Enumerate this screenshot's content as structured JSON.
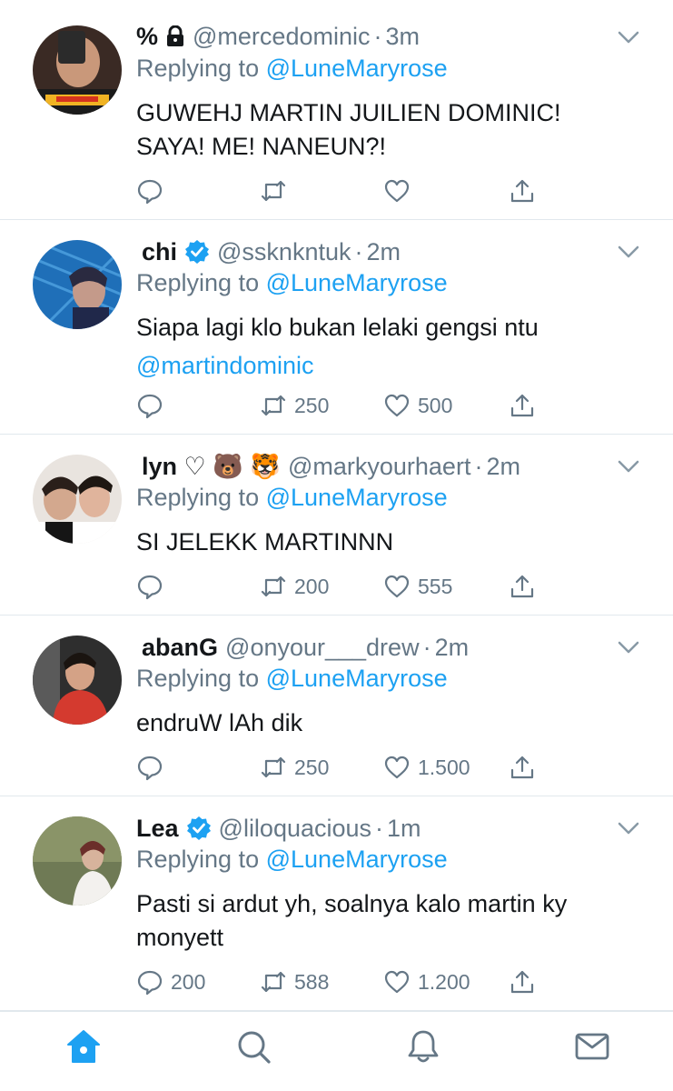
{
  "colors": {
    "accent": "#1da1f2",
    "muted": "#657786",
    "text": "#14171a",
    "divider": "#e1e8ed"
  },
  "tweets": [
    {
      "name": "%",
      "name_icon": "lock-icon",
      "handle": "@mercedominic",
      "dot": "·",
      "time": "3m",
      "reply_prefix": "Replying to",
      "reply_to": "@LuneMaryrose",
      "text_lines": [
        "GUWEHJ MARTIN JUILIEN DOMINIC!",
        "SAYA! ME! NANEUN?!"
      ],
      "mention_line": "",
      "reply_count": "",
      "retweet_count": "",
      "like_count": ""
    },
    {
      "name": "chi",
      "name_icon": "verified-badge-icon",
      "handle": "@ssknkntuk",
      "dot": "·",
      "time": "2m",
      "reply_prefix": "Replying to",
      "reply_to": "@LuneMaryrose",
      "text_lines": [
        "Siapa lagi klo bukan lelaki gengsi ntu"
      ],
      "mention_line": "@martindominic",
      "reply_count": "",
      "retweet_count": "250",
      "like_count": "500"
    },
    {
      "name": "lyn ♡ 🐻 🐯",
      "name_icon": "",
      "handle": "@markyourhaert",
      "dot": "·",
      "time": "2m",
      "reply_prefix": "Replying to",
      "reply_to": "@LuneMaryrose",
      "text_lines": [
        "SI JELEKK MARTINNN"
      ],
      "mention_line": "",
      "reply_count": "",
      "retweet_count": "200",
      "like_count": "555"
    },
    {
      "name": "abanG",
      "name_icon": "",
      "handle": "@onyour___drew",
      "dot": "·",
      "time": "2m",
      "reply_prefix": "Replying to",
      "reply_to": "@LuneMaryrose",
      "text_lines": [
        "endruW lAh dik"
      ],
      "mention_line": "",
      "reply_count": "",
      "retweet_count": "250",
      "like_count": "1.500"
    },
    {
      "name": "Lea",
      "name_icon": "verified-badge-icon",
      "handle": "@liloquacious",
      "dot": "·",
      "time": "1m",
      "reply_prefix": "Replying to",
      "reply_to": "@LuneMaryrose",
      "text_lines": [
        "Pasti si ardut yh, soalnya kalo martin ky",
        "monyett"
      ],
      "mention_line": "",
      "reply_count": "200",
      "retweet_count": "588",
      "like_count": "1.200"
    }
  ],
  "tabbar": {
    "items": [
      {
        "icon": "home-icon",
        "active": true
      },
      {
        "icon": "search-icon",
        "active": false
      },
      {
        "icon": "bell-icon",
        "active": false
      },
      {
        "icon": "mail-icon",
        "active": false
      }
    ]
  }
}
